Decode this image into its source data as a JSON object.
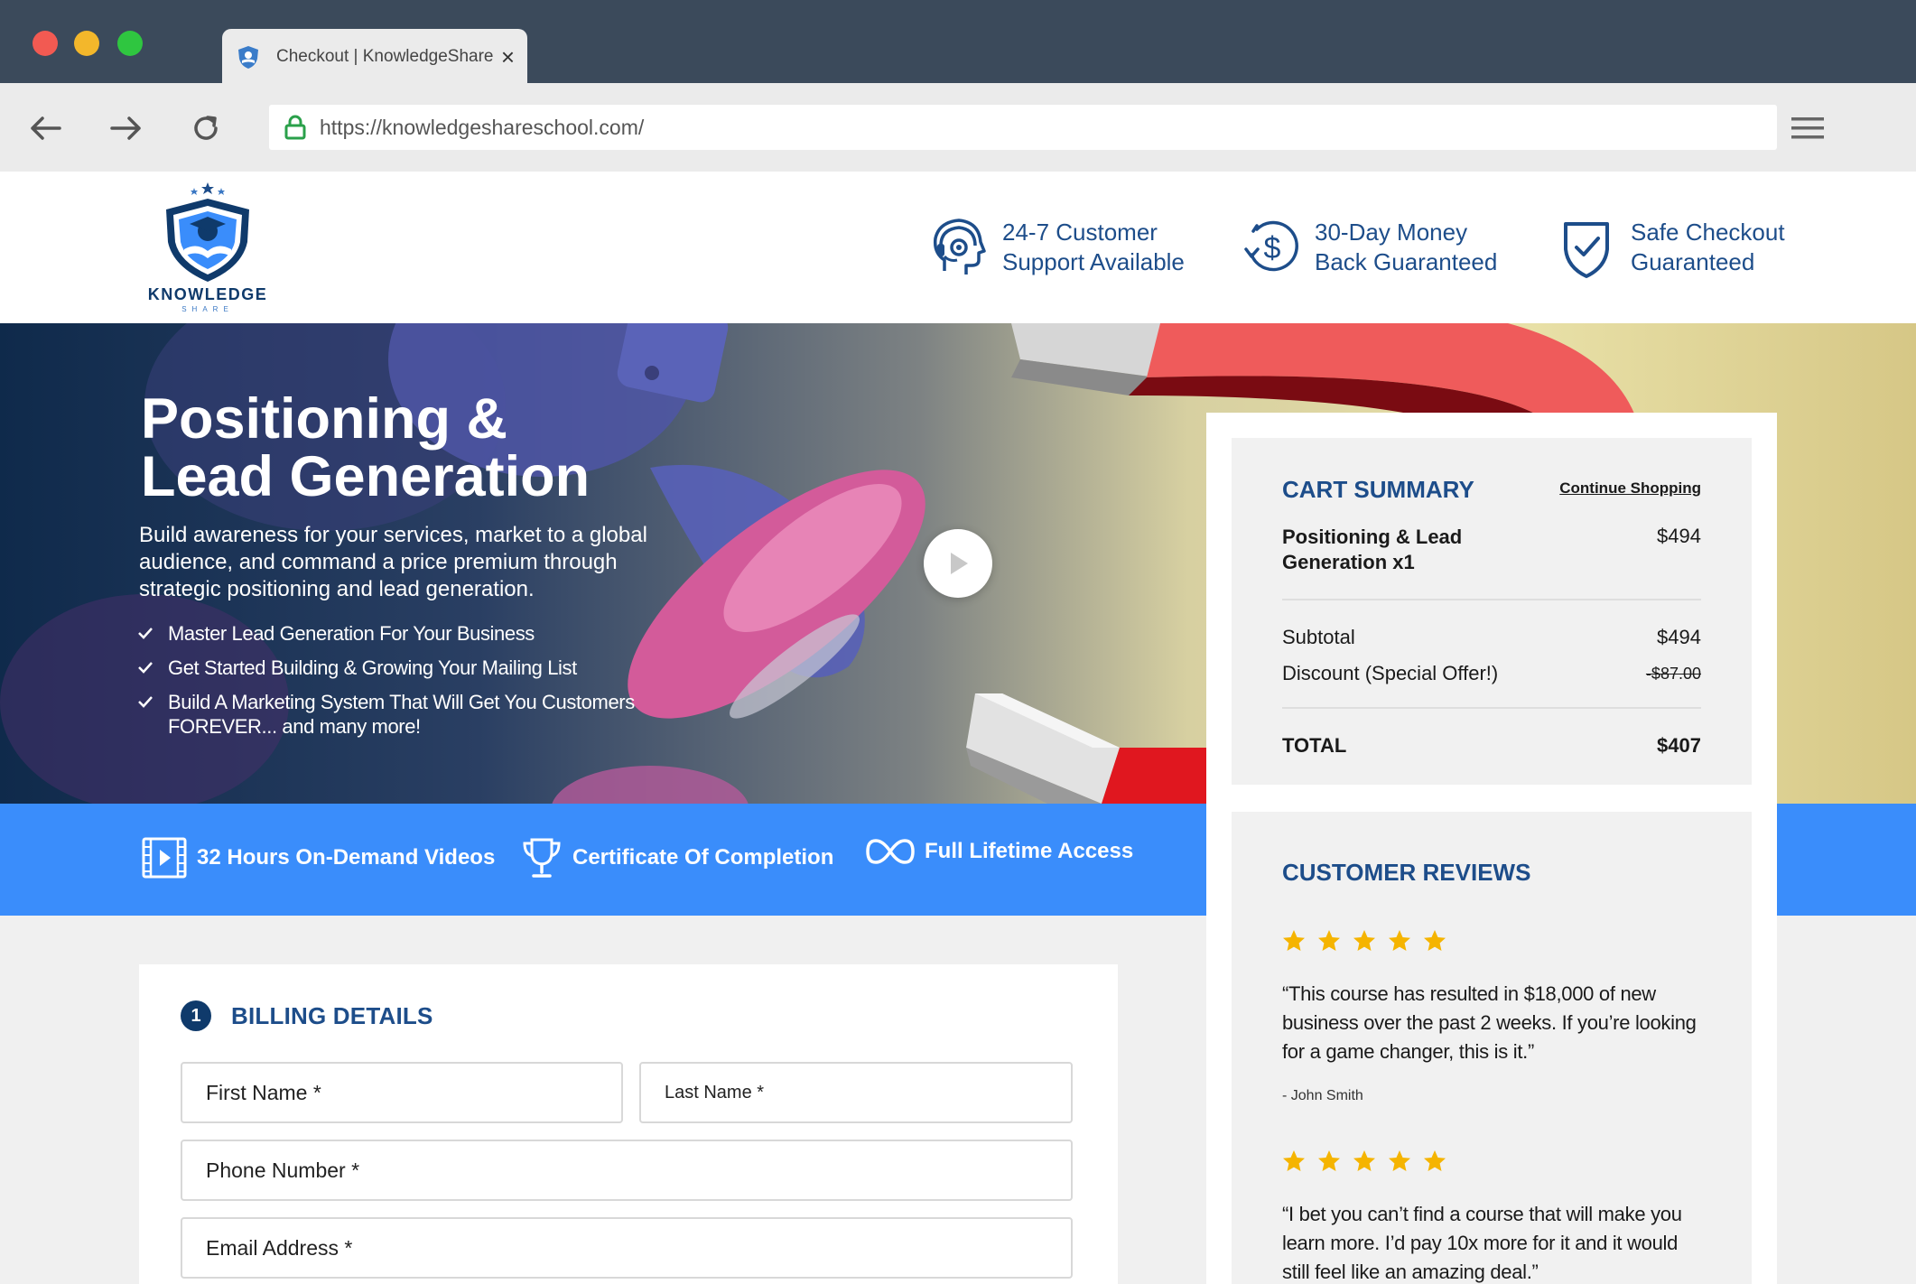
{
  "browser": {
    "tab_title": "Checkout | KnowledgeShare",
    "url": "https://knowledgeshareschool.com/"
  },
  "header": {
    "logo_word": "KNOWLEDGE",
    "logo_sub": "SHARE",
    "features": [
      {
        "icon": "headset-icon",
        "line1": "24-7 Customer",
        "line2": "Support Available"
      },
      {
        "icon": "money-back-icon",
        "line1": "30-Day Money",
        "line2": "Back Guaranteed"
      },
      {
        "icon": "shield-check-icon",
        "line1": "Safe Checkout",
        "line2": "Guaranteed"
      }
    ]
  },
  "hero": {
    "title_line1": "Positioning &",
    "title_line2": "Lead Generation",
    "description": "Build awareness for your services, market to a global audience, and command a price premium through strategic positioning and lead generation.",
    "bullets": [
      "Master Lead Generation For Your Business",
      "Get Started Building & Growing Your Mailing List",
      "Build A Marketing System That Will Get You Customers FOREVER... and many more!"
    ]
  },
  "strip": {
    "items": [
      {
        "icon": "video-icon",
        "label": "32 Hours On-Demand Videos"
      },
      {
        "icon": "trophy-icon",
        "label": "Certificate Of Completion"
      },
      {
        "icon": "infinity-icon",
        "label": "Full Lifetime Access"
      }
    ]
  },
  "billing": {
    "step": "1",
    "title": "BILLING DETAILS",
    "first_name_placeholder": "First Name *",
    "last_name_placeholder": "Last Name *",
    "phone_placeholder": "Phone Number *",
    "email_placeholder": "Email Address *"
  },
  "cart": {
    "title": "CART SUMMARY",
    "continue_label": "Continue Shopping",
    "item_name": "Positioning & Lead Generation x1",
    "item_price": "$494",
    "subtotal_label": "Subtotal",
    "subtotal_value": "$494",
    "discount_label": "Discount (Special Offer!)",
    "discount_value": "-$87.00",
    "total_label": "TOTAL",
    "total_value": "$407"
  },
  "reviews": {
    "title": "CUSTOMER REVIEWS",
    "items": [
      {
        "rating": 5,
        "quote": "“This course has resulted in $18,000 of new business over the past 2 weeks. If you’re looking for a game changer, this is it.”",
        "author": "- John Smith"
      },
      {
        "rating": 5,
        "quote": "“I bet you can’t find a course that will make you learn more. I’d pay 10x more for it and it would still feel like an amazing deal.”"
      }
    ]
  },
  "colors": {
    "brand_dark": "#0f3a6b",
    "brand_blue": "#1d4d8a",
    "strip_blue": "#3a8dfb",
    "star": "#f5b400"
  }
}
